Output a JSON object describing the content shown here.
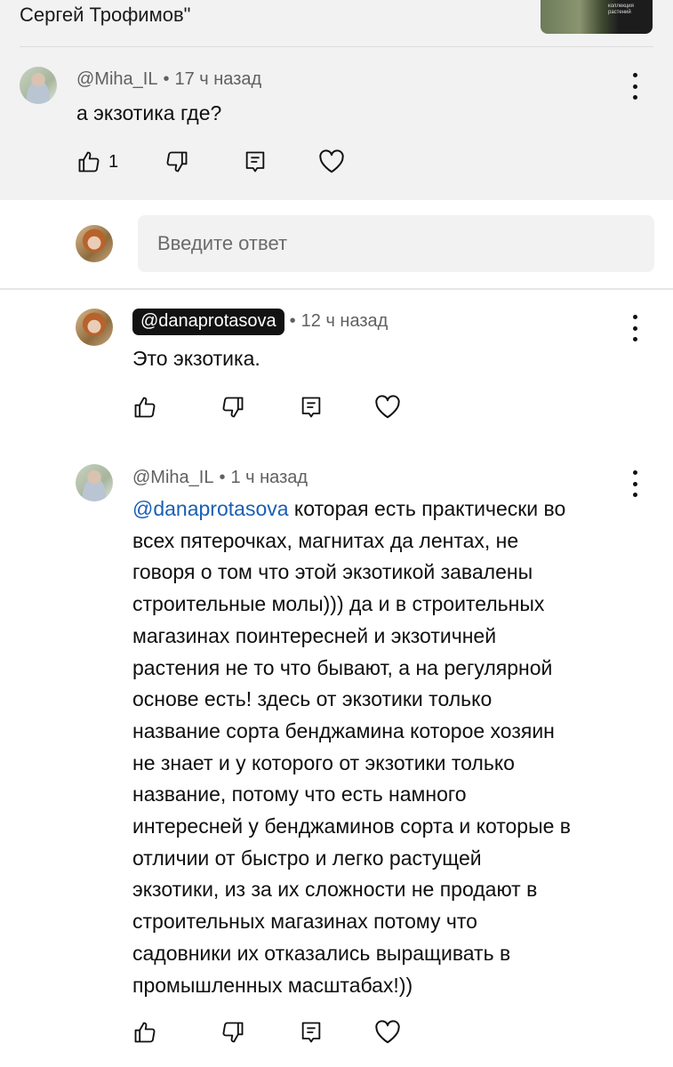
{
  "previous_comment": {
    "author_tail": "Сергей Трофимов\"",
    "thumbnail_caption": "коллекция растений"
  },
  "comment1": {
    "author": "@Miha_IL",
    "time": "17 ч назад",
    "text": "а экзотика где?",
    "like_count": "1"
  },
  "reply_input": {
    "placeholder": "Введите ответ"
  },
  "reply1": {
    "author": "@danaprotasova",
    "time": "12 ч назад",
    "text": "Это экзотика."
  },
  "reply2": {
    "author": "@Miha_IL",
    "time": "1 ч назад",
    "mention": "@danaprotasova",
    "lines": [
      "которая есть практически во",
      "всех пятерочках, магнитах да лентах, не",
      "говоря о том что этой экзотикой завалены",
      "строительные молы))) да и в строительных",
      "магазинах поинтересней и экзотичней",
      "растения не то что бывают, а на регулярной",
      "основе есть! здесь от экзотики только",
      "название сорта бенджамина которое хозяин",
      "не знает и у которого от экзотики только",
      "название, потому что есть намного",
      "интересней у бенджаминов сорта и которые в",
      "отличии от быстро и легко растущей",
      "экзотики, из за их сложности не продают в",
      "строительных магазинах потому что",
      "садовники их отказались выращивать в",
      "промышленных масштабах!))"
    ]
  },
  "icons": [
    "thumb-up-icon",
    "thumb-down-icon",
    "reply-icon",
    "heart-icon",
    "more-vert-icon"
  ]
}
